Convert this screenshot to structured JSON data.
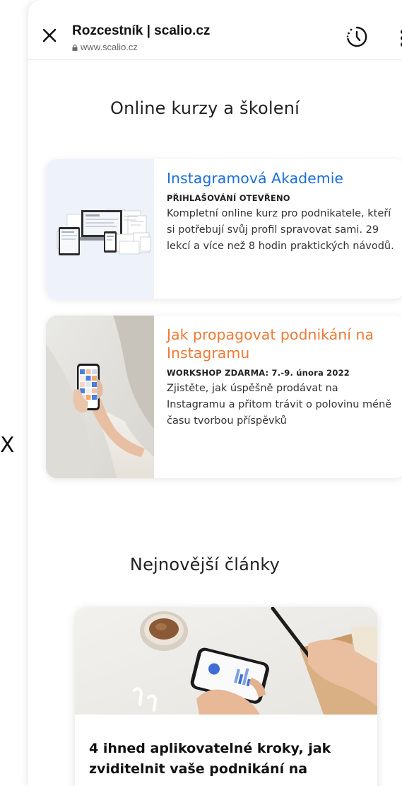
{
  "browser": {
    "title": "Rozcestník | scalio.cz",
    "url": "www.scalio.cz",
    "close_icon": "close-icon",
    "history_icon": "history-icon",
    "menu_icon": "more-vertical-icon"
  },
  "courses": {
    "heading": "Online kurzy a školení",
    "items": [
      {
        "title": "Instagramová Akademie",
        "tag": "PŘIHLAŠOVÁNÍ OTEVŘENO",
        "description": "Kompletní online kurz pro podnikatele, kteří si potřebují svůj profil spravovat sami. 29 lekcí a více než 8 hodin praktických návodů.",
        "title_color": "#1a6fd8"
      },
      {
        "title": "Jak propagovat podnikání na Instagramu",
        "tag": "WORKSHOP ZDARMA: 7.-9. února 2022",
        "description": "Zjistěte, jak úspěšně prodávat na Instagramu a přitom trávit o polovinu méně času tvorbou příspěvků",
        "title_color": "#ee7a35"
      }
    ]
  },
  "articles": {
    "heading": "Nejnovější články",
    "items": [
      {
        "title": "4 ihned aplikovatelné kroky, jak zviditelnit vaše podnikání na"
      }
    ]
  },
  "backdrop": {
    "close_glyph": "X"
  }
}
